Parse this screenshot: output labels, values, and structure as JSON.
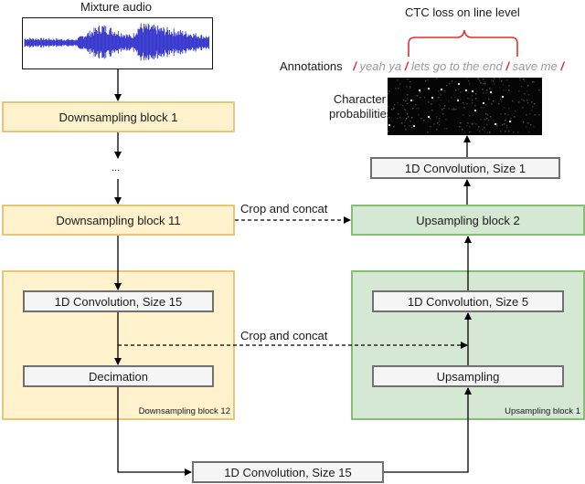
{
  "input": {
    "title": "Mixture audio",
    "waveform_color": "#3333cc"
  },
  "encoder": {
    "block_1": "Downsampling block 1",
    "ellipsis": "...",
    "block_11": "Downsampling block 11",
    "block_12": {
      "label": "Downsampling block 12",
      "conv": "1D Convolution, Size 15",
      "decimation": "Decimation"
    }
  },
  "bottleneck": {
    "conv": "1D Convolution, Size 15"
  },
  "decoder": {
    "block_1": {
      "label": "Upsampling block 1",
      "upsampling": "Upsampling",
      "conv": "1D Convolution, Size 5"
    },
    "block_2": "Upsampling block 2",
    "output_conv": "1D Convolution, Size 1"
  },
  "skip_connections": {
    "top": "Crop and concat",
    "bottom": "Crop and concat"
  },
  "output": {
    "ctc_label": "CTC loss on line level",
    "annotations_label": "Annotations",
    "annotation_segments": [
      "yeah ya",
      "lets go to the end",
      "save me"
    ],
    "separator": "/",
    "char_prob_label_line1": "Character",
    "char_prob_label_line2": "probabilities"
  },
  "colors": {
    "encoder_fill": "#fff2cc",
    "encoder_border": "#e5c77a",
    "decoder_fill": "#d5e8d4",
    "decoder_border": "#86be74",
    "layer_fill": "#f5f5f5",
    "separator_red": "#e03030",
    "annotation_grey": "#9a9a9a"
  }
}
